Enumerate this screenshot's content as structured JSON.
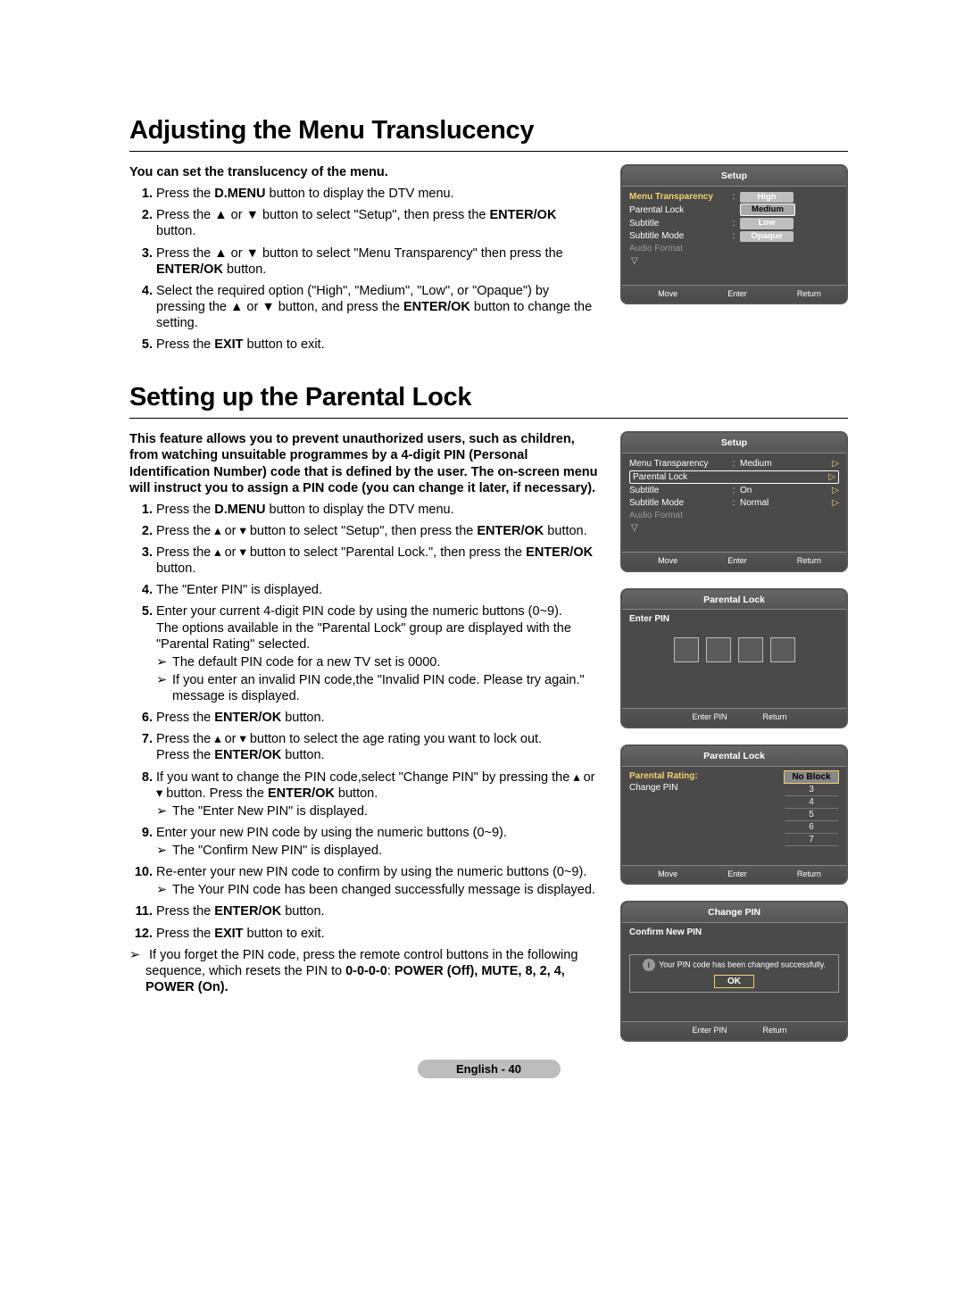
{
  "section1": {
    "heading": "Adjusting the Menu Translucency",
    "intro": "You can set the translucency of the menu.",
    "steps": {
      "s1": {
        "pre": "Press the ",
        "b1": "D.MENU",
        "post": " button to display the DTV menu."
      },
      "s2": {
        "pre": "Press the ▲ or ▼ button to select \"Setup\", then press the ",
        "b1": "ENTER/OK",
        "post": " button."
      },
      "s3": {
        "pre": "Press the ▲ or ▼ button to select \"Menu Transparency\" then press the ",
        "b1": "ENTER/OK",
        "post": " button."
      },
      "s4": {
        "pre": "Select the required option (\"High\", \"Medium\", \"Low\", or \"Opaque\") by pressing the ▲ or ▼ button, and press the ",
        "b1": "ENTER/OK",
        "post": " button to change the setting."
      },
      "s5": {
        "pre": "Press the ",
        "b1": "EXIT",
        "post": " button to exit."
      }
    }
  },
  "section2": {
    "heading": "Setting up the Parental Lock",
    "intro": "This feature allows you to prevent unauthorized users, such as children, from watching unsuitable programmes by a 4-digit PIN (Personal Identification Number) code that is defined by the user.  The on-screen menu will instruct you to assign a PIN code (you can change it later, if necessary).",
    "steps": {
      "s1": {
        "pre": "Press the ",
        "b1": "D.MENU",
        "post": " button to display the DTV menu."
      },
      "s2": {
        "pre": "Press the ▴ or ▾ button to select \"Setup\", then press the ",
        "b1": "ENTER/OK",
        "post": " button."
      },
      "s3": {
        "pre": "Press the ▴ or ▾ button to select \"Parental Lock.\", then press the ",
        "b1": "ENTER/OK",
        "post": " button."
      },
      "s4": {
        "text": "The \"Enter PIN\" is displayed."
      },
      "s5": {
        "text": "Enter your current 4-digit PIN code by using the numeric buttons (0~9).",
        "text2": "The options available in the \"Parental Lock\" group are displayed with the \"Parental Rating\" selected.",
        "sub1": "The default PIN code for a new TV set is 0000.",
        "sub2": "If you enter an invalid PIN code,the \"Invalid PIN code. Please try again.\" message is displayed."
      },
      "s6": {
        "pre": "Press the ",
        "b1": "ENTER/OK",
        "post": " button."
      },
      "s7": {
        "text": "Press the ▴ or ▾ button to select the age rating you want to lock out.",
        "pre2": "Press the ",
        "b2": "ENTER/OK",
        "post2": " button."
      },
      "s8": {
        "text": "If you want to change the PIN code,select \"Change PIN\" by pressing the ▴ or ▾ button. Press the ",
        "b1": "ENTER/OK",
        "post": " button.",
        "sub1": "The \"Enter New PIN\" is displayed."
      },
      "s9": {
        "text": "Enter your new PIN code by using the numeric buttons (0~9).",
        "sub1": "The \"Confirm New PIN\" is displayed."
      },
      "s10": {
        "text": "Re-enter your new PIN code to confirm by using the numeric buttons (0~9).",
        "sub1": "The Your PIN code has been changed successfully message is displayed."
      },
      "s11": {
        "pre": "Press the ",
        "b1": "ENTER/OK",
        "post": " button."
      },
      "s12": {
        "pre": "Press the ",
        "b1": "EXIT",
        "post": " button to exit."
      }
    },
    "note": {
      "pre": "If you forget the PIN code, press the remote control buttons in the following sequence, which resets the PIN to ",
      "b1": "0-0-0-0",
      "b2": "POWER (Off), MUTE, 8, 2, 4, POWER (On).",
      "colon": ": "
    }
  },
  "osd1": {
    "title": "Setup",
    "rows": {
      "r1": {
        "label": "Menu Transparency",
        "val": ""
      },
      "r2": {
        "label": "Parental Lock",
        "val": ""
      },
      "r3": {
        "label": "Subtitle",
        "val": ""
      },
      "r4": {
        "label": "Subtitle Mode",
        "val": ""
      },
      "r5": {
        "label": "Audio Format"
      }
    },
    "opts": {
      "o1": "High",
      "o2": "Medium",
      "o3": "Low",
      "o4": "Opaque"
    },
    "foot": {
      "move": "Move",
      "enter": "Enter",
      "ret": "Return"
    }
  },
  "osd2": {
    "title": "Setup",
    "rows": {
      "r1": {
        "label": "Menu Transparency",
        "val": "Medium"
      },
      "r2": {
        "label": "Parental Lock",
        "val": ""
      },
      "r3": {
        "label": "Subtitle",
        "val": "On"
      },
      "r4": {
        "label": "Subtitle  Mode",
        "val": "Normal"
      },
      "r5": {
        "label": "Audio Format"
      }
    },
    "foot": {
      "move": "Move",
      "enter": "Enter",
      "ret": "Return"
    }
  },
  "osd3": {
    "title": "Parental Lock",
    "label": "Enter PIN",
    "foot": {
      "enter": "Enter PIN",
      "ret": "Return"
    }
  },
  "osd4": {
    "title": "Parental Lock",
    "rows": {
      "r1": "Parental Rating:",
      "r2": "Change PIN"
    },
    "ratings": {
      "r0": "No Block",
      "r1": "3",
      "r2": "4",
      "r3": "5",
      "r4": "6",
      "r5": "7"
    },
    "foot": {
      "move": "Move",
      "enter": "Enter",
      "ret": "Return"
    }
  },
  "osd5": {
    "title": "Change PIN",
    "label": "Confirm New PIN",
    "msg": "Your PIN code has been changed successfully.",
    "ok": "OK",
    "foot": {
      "enter": "Enter PIN",
      "ret": "Return"
    }
  },
  "footer": "English - 40"
}
